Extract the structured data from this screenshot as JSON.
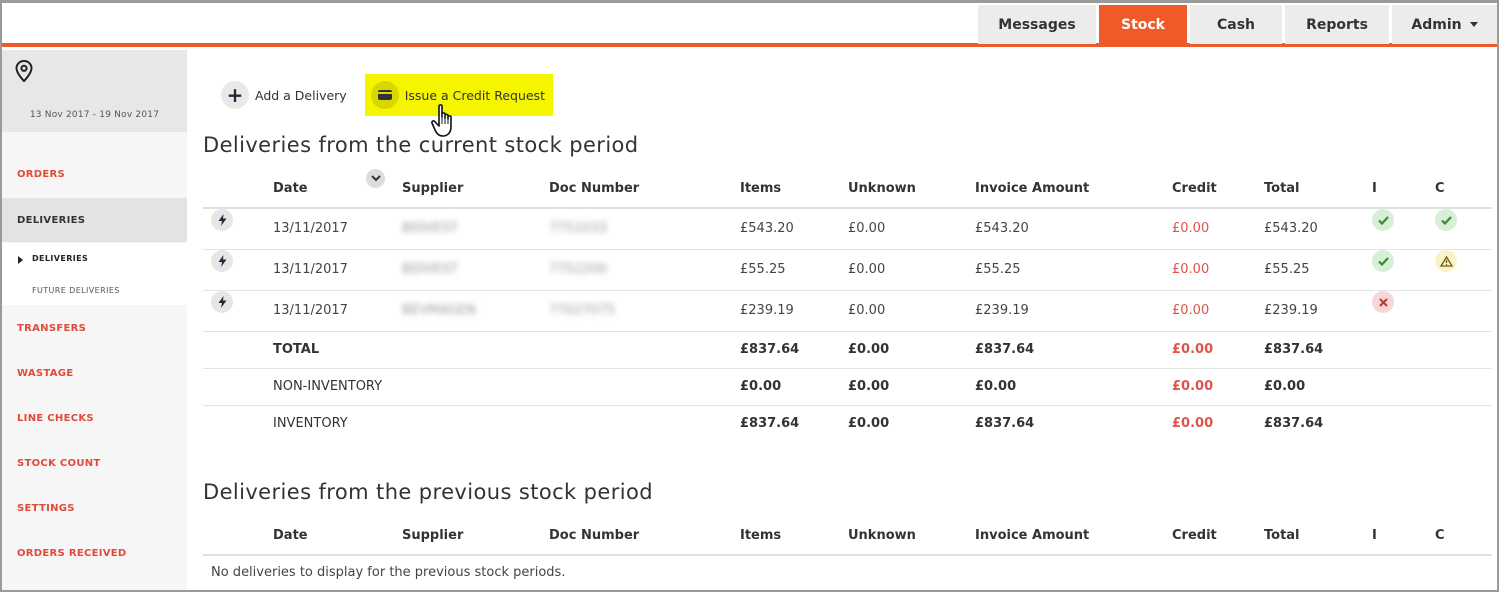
{
  "nav": {
    "tabs": [
      {
        "label": "Messages",
        "active": false
      },
      {
        "label": "Stock",
        "active": true
      },
      {
        "label": "Cash",
        "active": false
      },
      {
        "label": "Reports",
        "active": false
      },
      {
        "label": "Admin",
        "active": false
      }
    ],
    "accent_color": "#f05a28"
  },
  "sidebar": {
    "date_range": "13 Nov 2017 - 19 Nov 2017",
    "items": [
      {
        "label": "ORDERS"
      },
      {
        "label": "DELIVERIES"
      },
      {
        "label": "TRANSFERS"
      },
      {
        "label": "WASTAGE"
      },
      {
        "label": "LINE CHECKS"
      },
      {
        "label": "STOCK COUNT"
      },
      {
        "label": "SETTINGS"
      },
      {
        "label": "ORDERS RECEIVED"
      }
    ],
    "sub_items": [
      {
        "label": "DELIVERIES"
      },
      {
        "label": "FUTURE DELIVERIES"
      }
    ]
  },
  "actions": {
    "add_delivery": "Add a Delivery",
    "issue_credit": "Issue a Credit Request"
  },
  "current": {
    "title": "Deliveries from the current stock period",
    "columns": [
      "Date",
      "Supplier",
      "Doc Number",
      "Items",
      "Unknown",
      "Invoice Amount",
      "Credit",
      "Total",
      "I",
      "C"
    ],
    "rows": [
      {
        "date": "13/11/2017",
        "supplier": "BIDVEST",
        "doc": "7751033",
        "items": "£543.20",
        "unknown": "£0.00",
        "invoice": "£543.20",
        "credit": "£0.00",
        "total": "£543.20",
        "i_status": "check-icon",
        "c_status": "check-icon"
      },
      {
        "date": "13/11/2017",
        "supplier": "BIDVEST",
        "doc": "7752200",
        "items": "£55.25",
        "unknown": "£0.00",
        "invoice": "£55.25",
        "credit": "£0.00",
        "total": "£55.25",
        "i_status": "check-icon",
        "c_status": "warning-icon"
      },
      {
        "date": "13/11/2017",
        "supplier": "BEVMAGEN",
        "doc": "77027075",
        "items": "£239.19",
        "unknown": "£0.00",
        "invoice": "£239.19",
        "credit": "£0.00",
        "total": "£239.19",
        "i_status": "cross-icon",
        "c_status": ""
      }
    ],
    "summary": [
      {
        "label": "TOTAL",
        "items": "£837.64",
        "unknown": "£0.00",
        "invoice": "£837.64",
        "credit": "£0.00",
        "total": "£837.64"
      },
      {
        "label": "NON-INVENTORY",
        "items": "£0.00",
        "unknown": "£0.00",
        "invoice": "£0.00",
        "credit": "£0.00",
        "total": "£0.00"
      },
      {
        "label": "INVENTORY",
        "items": "£837.64",
        "unknown": "£0.00",
        "invoice": "£837.64",
        "credit": "£0.00",
        "total": "£837.64"
      }
    ]
  },
  "previous": {
    "title": "Deliveries from the previous stock period",
    "columns": [
      "Date",
      "Supplier",
      "Doc Number",
      "Items",
      "Unknown",
      "Invoice Amount",
      "Credit",
      "Total",
      "I",
      "C"
    ],
    "empty_message": "No deliveries to display for the previous stock periods."
  }
}
